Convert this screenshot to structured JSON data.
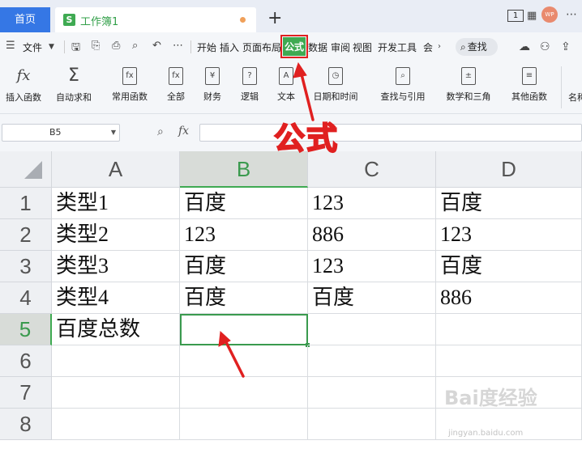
{
  "tabs": {
    "home": "首页",
    "doc_badge": "S",
    "doc_name": "工作簿1",
    "new_tab": "+",
    "window_count": "1",
    "avatar": "WP"
  },
  "menu": {
    "file": "文件",
    "items": [
      "开始",
      "插入",
      "页面布局",
      "公式",
      "数据",
      "审阅",
      "视图",
      "开发工具",
      "会"
    ],
    "active": "公式",
    "search": "查找"
  },
  "ribbon": {
    "buttons": [
      {
        "label": "插入函数",
        "icon": "fx"
      },
      {
        "label": "自动求和",
        "icon": "Σ"
      },
      {
        "label": "常用函数",
        "icon": "fx"
      },
      {
        "label": "全部",
        "icon": "fx"
      },
      {
        "label": "财务",
        "icon": "¥"
      },
      {
        "label": "逻辑",
        "icon": "?"
      },
      {
        "label": "文本",
        "icon": "A"
      },
      {
        "label": "日期和时间",
        "icon": "◷"
      },
      {
        "label": "查找与引用",
        "icon": "⌕"
      },
      {
        "label": "数学和三角",
        "icon": "±"
      },
      {
        "label": "其他函数",
        "icon": "≡"
      },
      {
        "label": "名称",
        "icon": ""
      }
    ]
  },
  "formula_bar": {
    "name_box": "B5",
    "fx": "fx",
    "value": ""
  },
  "annotation": {
    "label": "公式",
    "color": "#e02020"
  },
  "sheet": {
    "columns": [
      "A",
      "B",
      "C",
      "D"
    ],
    "rows": [
      "1",
      "2",
      "3",
      "4",
      "5",
      "6",
      "7",
      "8"
    ],
    "selected_cell": "B5",
    "cells": [
      [
        "类型1",
        "百度",
        "123",
        "百度"
      ],
      [
        "类型2",
        "123",
        "886",
        "123"
      ],
      [
        "类型3",
        "百度",
        "123",
        "百度"
      ],
      [
        "类型4",
        "百度",
        "百度",
        "886"
      ],
      [
        "百度总数",
        "",
        "",
        ""
      ],
      [
        "",
        "",
        "",
        ""
      ],
      [
        "",
        "",
        "",
        ""
      ],
      [
        "",
        "",
        "",
        ""
      ]
    ]
  },
  "watermark": {
    "main": "Bai度经验",
    "sub": "jingyan.baidu.com"
  }
}
